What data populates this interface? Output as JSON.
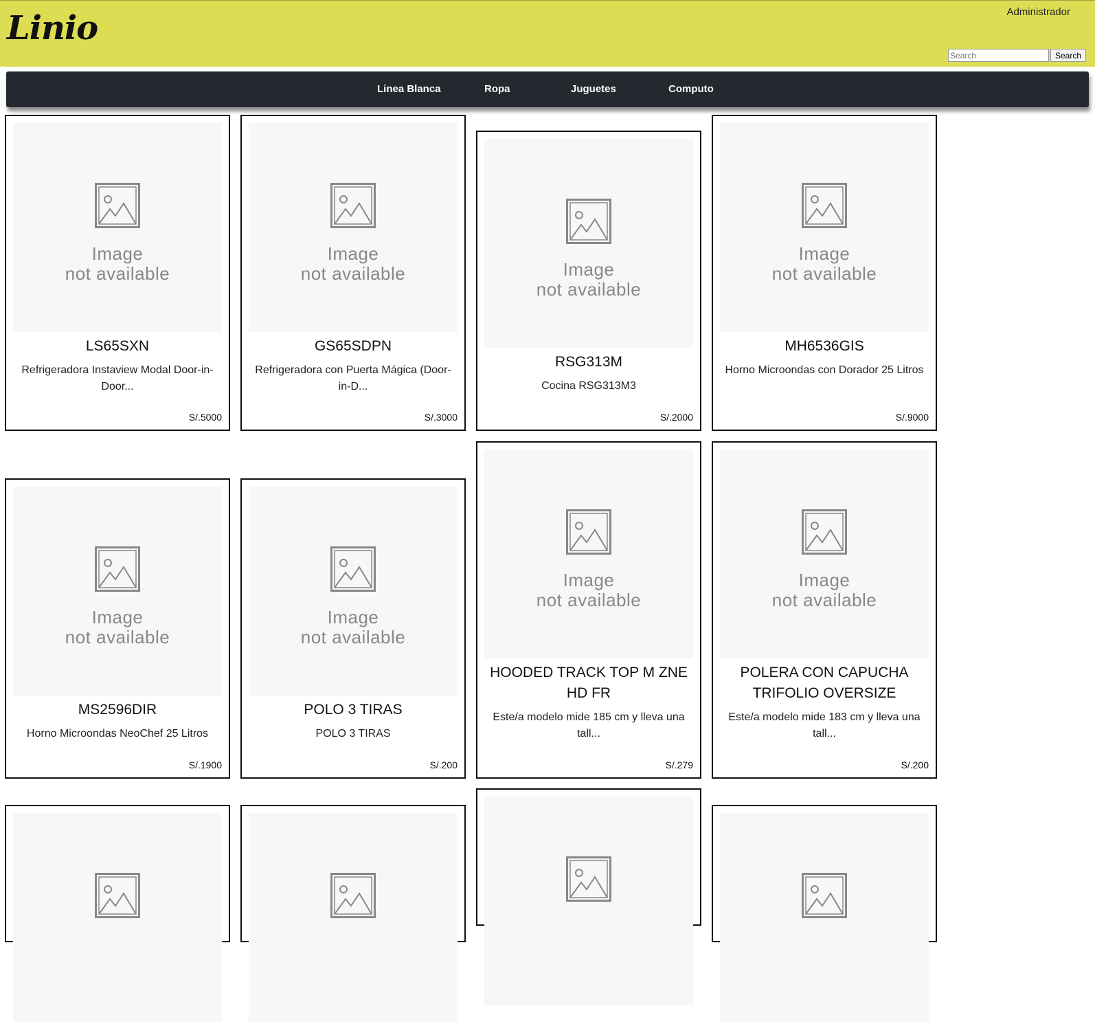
{
  "header": {
    "logo": "Linio",
    "user": "Administrador",
    "search_placeholder": "Search",
    "search_button": "Search",
    "background": "#dcdd53"
  },
  "nav": {
    "items": [
      "Linea Blanca",
      "Ropa",
      "Juguetes",
      "Computo"
    ],
    "background": "#23292e"
  },
  "placeholder": {
    "line1": "Image",
    "line2": "not available",
    "icon": "image-placeholder-icon"
  },
  "products": [
    {
      "name": "LS65SXN",
      "description": "Refrigeradora Instaview Modal Door-in-Door...",
      "price": "S/.5000"
    },
    {
      "name": "GS65SDPN",
      "description": "Refrigeradora con Puerta Mágica (Door-in-D...",
      "price": "S/.3000"
    },
    {
      "name": "RSG313M",
      "description": "Cocina RSG313M3",
      "price": "S/.2000"
    },
    {
      "name": "MH6536GIS",
      "description": "Horno Microondas con Dorador 25 Litros",
      "price": "S/.9000"
    },
    {
      "name": "MS2596DIR",
      "description": "Horno Microondas NeoChef 25 Litros",
      "price": "S/.1900"
    },
    {
      "name": "POLO 3 TIRAS",
      "description": "POLO 3 TIRAS",
      "price": "S/.200"
    },
    {
      "name": "HOODED TRACK TOP M ZNE HD FR",
      "description": "Este/a modelo mide 185 cm y lleva una tall...",
      "price": "S/.279"
    },
    {
      "name": "POLERA CON CAPUCHA TRIFOLIO OVERSIZE",
      "description": "Este/a modelo mide 183 cm y lleva una tall...",
      "price": "S/.200"
    },
    {
      "name": "",
      "description": "",
      "price": ""
    },
    {
      "name": "",
      "description": "",
      "price": ""
    },
    {
      "name": "",
      "description": "",
      "price": ""
    },
    {
      "name": "",
      "description": "",
      "price": ""
    }
  ]
}
